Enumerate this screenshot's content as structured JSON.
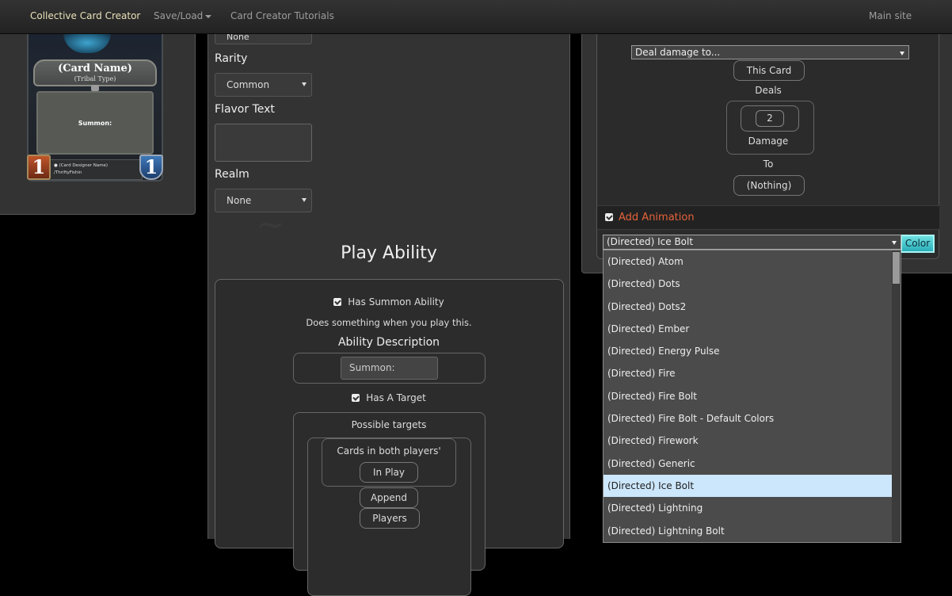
{
  "navbar": {
    "brand": "Collective Card Creator",
    "save_load": "Save/Load",
    "tutorials": "Card Creator Tutorials",
    "main_site": "Main site"
  },
  "card": {
    "name": "(Card Name)",
    "tribe": "(Tribal Type)",
    "text": "Summon:",
    "designer": "(Card Designer Name)",
    "artist": "ThriftyFishin",
    "attack": "1",
    "health": "1"
  },
  "editor": {
    "top_select": "None",
    "rarity_label": "Rarity",
    "rarity_value": "Common",
    "flavor_label": "Flavor Text",
    "realm_label": "Realm",
    "realm_value": "None",
    "play_ability_heading": "Play Ability",
    "has_summon_label": "Has Summon Ability",
    "summon_desc": "Does something when you play this.",
    "ability_desc_label": "Ability Description",
    "ability_desc_value": "Summon:",
    "has_target_label": "Has A Target",
    "possible_targets": "Possible targets",
    "cards_in_both": "Cards in both players'",
    "in_play": "In Play",
    "append": "Append",
    "players": "Players"
  },
  "effect": {
    "deal_damage_select": "Deal damage to...",
    "this_card": "This Card",
    "deals": "Deals",
    "damage_amount": "2",
    "damage": "Damage",
    "to": "To",
    "nothing": "(Nothing)",
    "add_animation": "Add Animation",
    "animation_selected": "(Directed) Ice Bolt",
    "color_button": "Color"
  },
  "animation_options": [
    "(Directed) Atom",
    "(Directed) Dots",
    "(Directed) Dots2",
    "(Directed) Ember",
    "(Directed) Energy Pulse",
    "(Directed) Fire",
    "(Directed) Fire Bolt",
    "(Directed) Fire Bolt - Default Colors",
    "(Directed) Firework",
    "(Directed) Generic",
    "(Directed) Ice Bolt",
    "(Directed) Lightning",
    "(Directed) Lightning Bolt"
  ],
  "animation_selected_index": 10,
  "colors": {
    "accent_orange": "#e5633a",
    "brand": "#e8e1b8",
    "selected_option": "#cce6fb",
    "color_button": "#2aaeb8"
  }
}
